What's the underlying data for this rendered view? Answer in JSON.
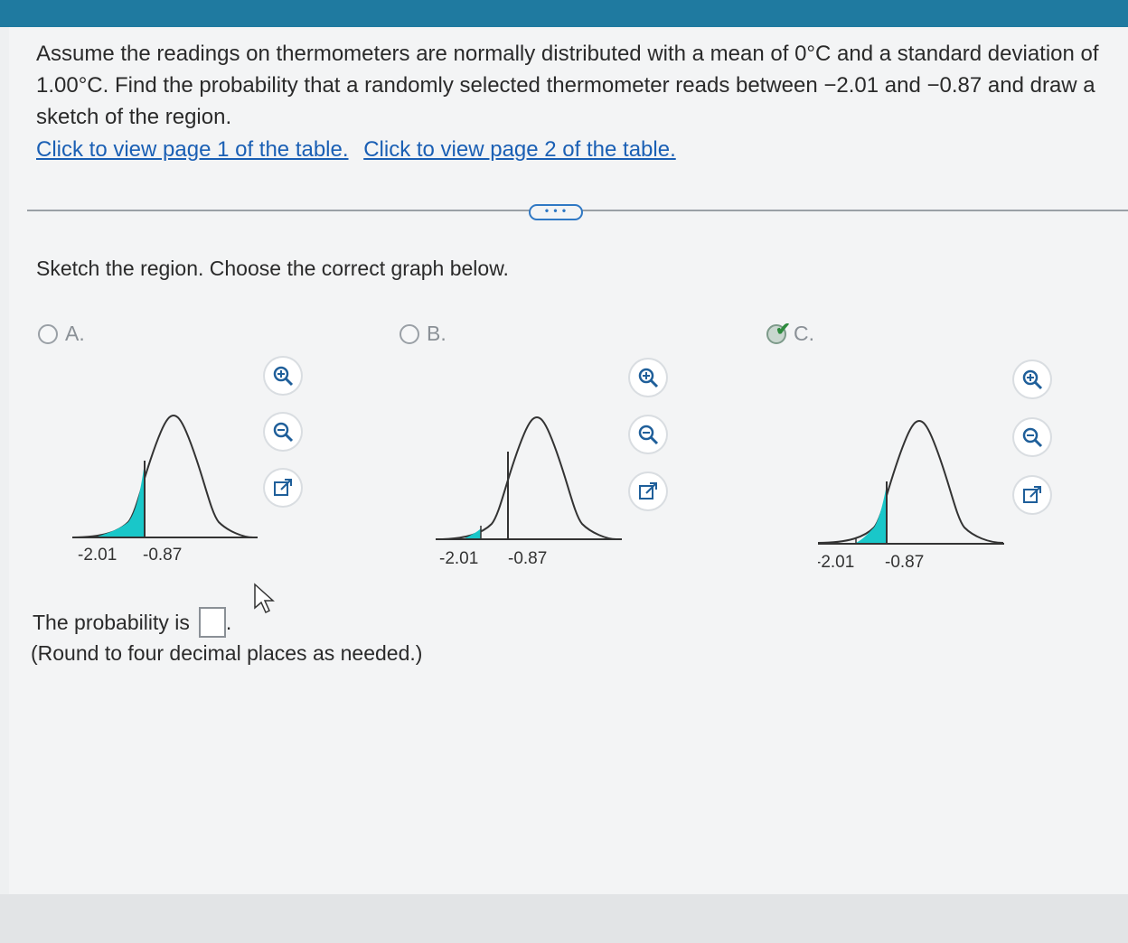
{
  "question": {
    "part1": "Assume the readings on thermometers are normally distributed with a mean of 0°C and a standard deviation of 1.00°C. Find the probability that a randomly selected thermometer reads between −2.01 and −0.87 and draw a sketch of the region."
  },
  "links": {
    "page1": "Click to view page 1 of the table.",
    "page2": "Click to view page 2 of the table."
  },
  "more_button": "• • •",
  "prompt": "Sketch the region. Choose the correct graph below.",
  "options": [
    {
      "label": "A.",
      "selected": false,
      "left_value": "-2.01",
      "right_value": "-0.87",
      "shading": "left-tail-to--0.87"
    },
    {
      "label": "B.",
      "selected": false,
      "left_value": "-2.01",
      "right_value": "-0.87",
      "shading": "left-tail-to--2.01"
    },
    {
      "label": "C.",
      "selected": true,
      "left_value": "-2.01",
      "right_value": "-0.87",
      "shading": "between--2.01-and--0.87"
    }
  ],
  "icons": [
    "zoom-in-icon",
    "zoom-out-icon",
    "external-link-icon"
  ],
  "answer": {
    "label": "The probability is",
    "value": "",
    "note": "(Round to four decimal places as needed.)"
  },
  "colors": {
    "accent": "#1f7aa0",
    "link": "#1a5fb4",
    "shade": "#19c7c9",
    "check": "#2e8b3e"
  }
}
